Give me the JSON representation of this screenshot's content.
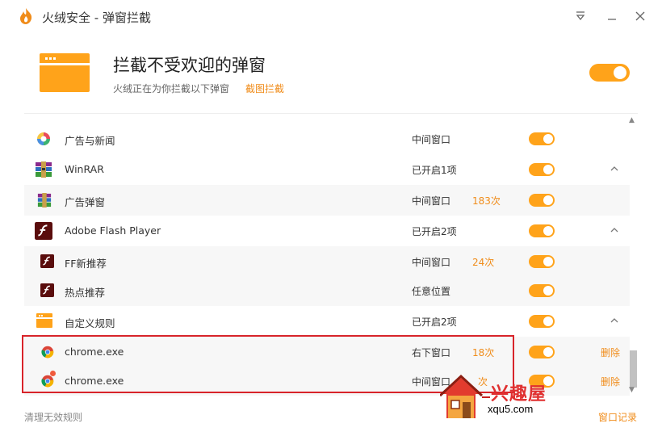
{
  "window": {
    "title": "火绒安全 - 弹窗拦截"
  },
  "header": {
    "title": "拦截不受欢迎的弹窗",
    "subtitle": "火绒正在为你拦截以下弹窗",
    "screenshot_link": "截图拦截",
    "enabled": true
  },
  "rows": [
    {
      "name": "广告与新闻",
      "position": "中间窗口",
      "count": "",
      "type": "child",
      "icon": "colorful-icon"
    },
    {
      "name": "WinRAR",
      "position": "已开启1项",
      "count": "",
      "type": "group",
      "icon": "winrar-icon"
    },
    {
      "name": "广告弹窗",
      "position": "中间窗口",
      "count": "183次",
      "type": "child",
      "icon": "winrar-icon"
    },
    {
      "name": "Adobe Flash Player",
      "position": "已开启2项",
      "count": "",
      "type": "group",
      "icon": "flash-icon"
    },
    {
      "name": "FF新推荐",
      "position": "中间窗口",
      "count": "24次",
      "type": "child",
      "icon": "flash-icon"
    },
    {
      "name": "热点推荐",
      "position": "任意位置",
      "count": "",
      "type": "child",
      "icon": "flash-icon"
    },
    {
      "name": "自定义规则",
      "position": "已开启2项",
      "count": "",
      "type": "group",
      "icon": "window-icon"
    },
    {
      "name": "chrome.exe",
      "position": "右下窗口",
      "count": "18次",
      "type": "child",
      "icon": "chrome-icon",
      "delete": "删除"
    },
    {
      "name": "chrome.exe",
      "position": "中间窗口",
      "count": "次",
      "type": "child",
      "icon": "chrome-icon",
      "delete": "删除"
    }
  ],
  "footer": {
    "clear": "清理无效规则",
    "log": "窗口记录"
  },
  "watermark": {
    "text": "兴趣屋",
    "url": "xqu5.com"
  }
}
